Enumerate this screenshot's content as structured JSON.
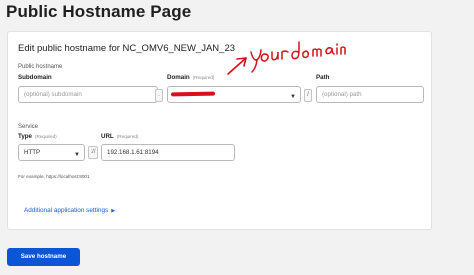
{
  "page": {
    "title": "Public Hostname Page"
  },
  "card": {
    "title": "Edit public hostname for NC_OMV6_NEW_JAN_23",
    "section_public": "Public hostname",
    "subdomain": {
      "label": "Subdomain",
      "placeholder": "(optional) subdomain",
      "value": ""
    },
    "dot_sep": ".",
    "domain": {
      "label": "Domain",
      "required": "(Required)",
      "value_redacted": true
    },
    "slash_sep": "/",
    "path": {
      "label": "Path",
      "placeholder": "(optional) path",
      "value": ""
    },
    "section_service": "Service",
    "type": {
      "label": "Type",
      "required": "(Required)",
      "value": "HTTP"
    },
    "proto_sep": "://",
    "url": {
      "label": "URL",
      "required": "(Required)",
      "value": "192.168.1.61:8194"
    },
    "helper": "For example, https://localhost:8001",
    "additional_settings": "Additional application settings",
    "chevron_right": "▶"
  },
  "annotation": {
    "text": "Your domain",
    "color": "#d4121a"
  },
  "actions": {
    "save_label": "Save hostname"
  }
}
